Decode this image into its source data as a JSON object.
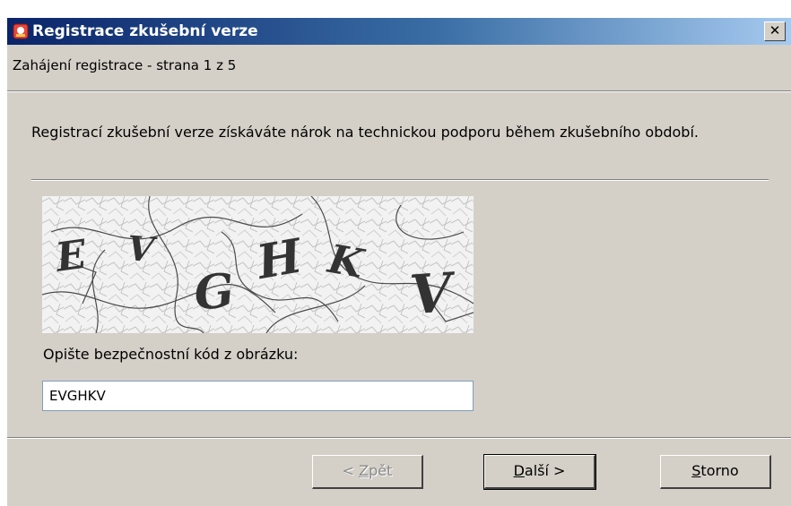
{
  "window": {
    "title": "Registrace zkušební verze",
    "close_label": "✕"
  },
  "header": {
    "step": "Zahájení registrace - strana 1 z 5"
  },
  "content": {
    "intro": "Registrací zkušební verze získáváte nárok na technickou podporu během zkušebního období.",
    "captcha_letters": [
      "E",
      "V",
      "G",
      "H",
      "K",
      "V"
    ],
    "prompt": "Opište bezpečnostní kód z obrázku:",
    "code_value": "EVGHKV"
  },
  "buttons": {
    "back": {
      "before": "< ",
      "mnemonic": "Z",
      "rest": "pět"
    },
    "next": {
      "before": "",
      "mnemonic": "D",
      "rest": "alší >"
    },
    "cancel": {
      "before": "",
      "mnemonic": "S",
      "rest": "torno"
    }
  },
  "icons": {
    "app": "registration-app-icon",
    "close": "close-icon"
  },
  "colors": {
    "titlebar_start": "#0a246a",
    "titlebar_end": "#a6caf0",
    "dialog_face": "#d4d0c8"
  }
}
